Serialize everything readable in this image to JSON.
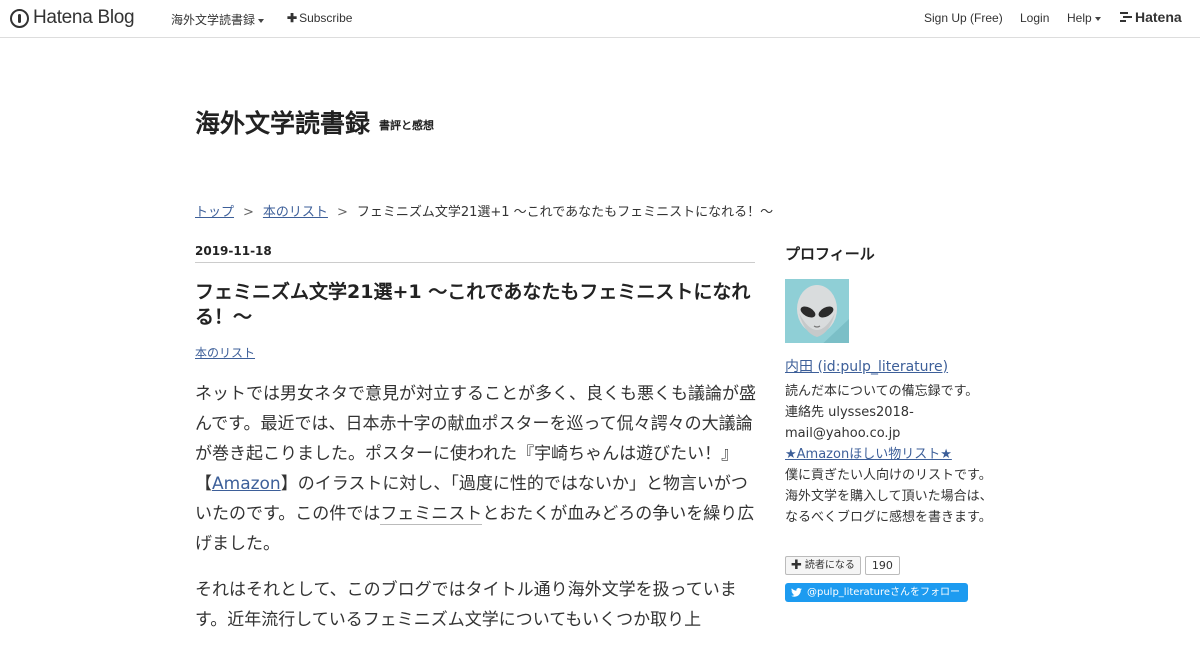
{
  "topnav": {
    "logo_text": "Hatena Blog",
    "blog_menu": "海外文学読書録",
    "subscribe": "Subscribe",
    "signup": "Sign Up (Free)",
    "login": "Login",
    "help": "Help",
    "brand": "Hatena"
  },
  "blog": {
    "title": "海外文学読書録",
    "description": "書評と感想"
  },
  "breadcrumb": {
    "top": "トップ",
    "list": "本のリスト",
    "current": "フェミニズム文学21選+1 ～これであなたもフェミニストになれる！～",
    "separator": ">"
  },
  "entry": {
    "date": "2019-11-18",
    "title": "フェミニズム文学21選+1 ～これであなたもフェミニストになれる！～",
    "category": "本のリスト",
    "p1_a": "ネットでは男女ネタで意見が対立することが多く、良くも悪くも議論が盛んです。最近では、日本赤十字の献血ポスターを巡って侃々諤々の大議論が巻き起こりました。ポスターに使われた『宇崎ちゃんは遊びたい！』【",
    "p1_link": "Amazon",
    "p1_b": "】のイラストに対し、「過度に性的ではないか」と物言いがついたのです。この件では",
    "p1_keyword": "フェミニスト",
    "p1_c": "とおたくが血みどろの争いを繰り広げました。",
    "p2": "それはそれとして、このブログではタイトル通り海外文学を扱っています。近年流行しているフェミニズム文学についてもいくつか取り上"
  },
  "sidebar": {
    "heading": "プロフィール",
    "profile_name": "内田 (id:pulp_literature)",
    "bio": "読んだ本についての備忘録です。",
    "contact": "連絡先 ulysses2018-mail@yahoo.co.jp",
    "wishlist_link": "★Amazonほしい物リスト★",
    "wishlist_text": "僕に貢ぎたい人向けのリストです。海外文学を購入して頂いた場合は、なるべくブログに感想を書きます。",
    "reader_button": "読者になる",
    "reader_count": "190",
    "follow_button": "@pulp_literatureさんをフォロー"
  },
  "colors": {
    "link": "#3d5f99",
    "twitter": "#1d9bf0",
    "avatar_bg": "#8fcfd6"
  }
}
